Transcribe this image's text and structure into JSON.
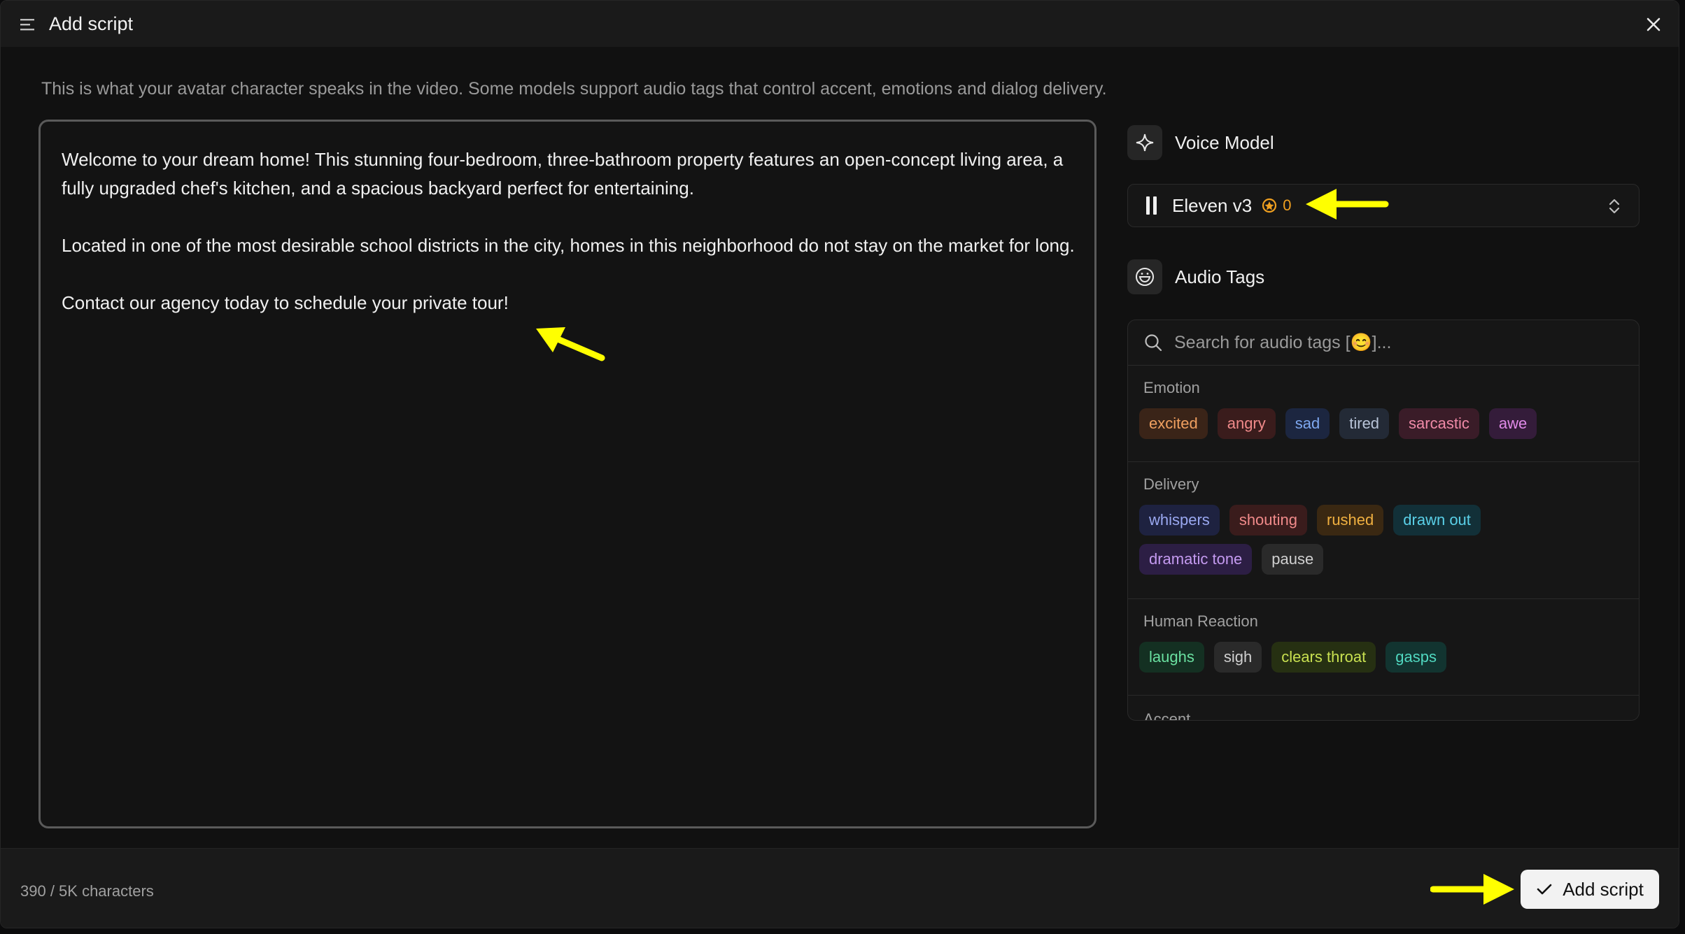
{
  "header": {
    "title": "Add script"
  },
  "subtitle": "This is what your avatar character speaks in the video. Some models support audio tags that control accent, emotions and dialog delivery.",
  "script": {
    "paragraphs": [
      "Welcome to your dream home! This stunning four-bedroom, three-bathroom property features an open-concept living area, a fully upgraded chef's kitchen, and a spacious backyard perfect for entertaining.",
      "Located in one of the most desirable school districts in the city, homes in this neighborhood do not stay on the market for long.",
      "Contact our agency today to schedule your private tour!"
    ]
  },
  "voice_model": {
    "label": "Voice Model",
    "selected": "Eleven v3",
    "credits": "0",
    "icon": "sparkle-icon"
  },
  "audio_tags": {
    "label": "Audio Tags",
    "icon": "smile-icon",
    "search_placeholder": "Search for audio tags [😊]...",
    "groups": [
      {
        "name": "Emotion",
        "tags": [
          {
            "label": "excited",
            "color": "#f0a060",
            "bg": "#3a2418"
          },
          {
            "label": "angry",
            "color": "#f08a8a",
            "bg": "#3a1c1c"
          },
          {
            "label": "sad",
            "color": "#7ea8f0",
            "bg": "#1c2640"
          },
          {
            "label": "tired",
            "color": "#b8c4d8",
            "bg": "#232a36"
          },
          {
            "label": "sarcastic",
            "color": "#f08aa8",
            "bg": "#3a1c28"
          },
          {
            "label": "awe",
            "color": "#e08ae8",
            "bg": "#341c3a"
          }
        ]
      },
      {
        "name": "Delivery",
        "tags": [
          {
            "label": "whispers",
            "color": "#9aa8f0",
            "bg": "#1e2240"
          },
          {
            "label": "shouting",
            "color": "#f08a8a",
            "bg": "#3a1c1c"
          },
          {
            "label": "rushed",
            "color": "#f0b040",
            "bg": "#3a2812"
          },
          {
            "label": "drawn out",
            "color": "#5ad0e8",
            "bg": "#123038"
          },
          {
            "label": "dramatic tone",
            "color": "#c49af0",
            "bg": "#2c1e44"
          },
          {
            "label": "pause",
            "color": "#d0d0d0",
            "bg": "#2a2a2a"
          }
        ]
      },
      {
        "name": "Human Reaction",
        "tags": [
          {
            "label": "laughs",
            "color": "#6ae0a0",
            "bg": "#143022"
          },
          {
            "label": "sigh",
            "color": "#d0d0d0",
            "bg": "#2a2a2a"
          },
          {
            "label": "clears throat",
            "color": "#c8e050",
            "bg": "#263012"
          },
          {
            "label": "gasps",
            "color": "#50d8c0",
            "bg": "#123430"
          }
        ]
      },
      {
        "name": "Accent",
        "tags": []
      }
    ]
  },
  "footer": {
    "char_count": "390 / 5K characters",
    "add_button": "Add script"
  },
  "colors": {
    "accent_arrow": "#ffff00",
    "credit": "#f0a020"
  }
}
